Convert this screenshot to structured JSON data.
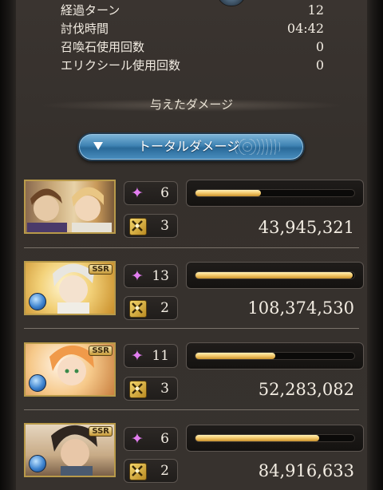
{
  "stats": [
    {
      "label": "経過ターン",
      "value": "12"
    },
    {
      "label": "討伐時間",
      "value": "04:42"
    },
    {
      "label": "召喚石使用回数",
      "value": "0"
    },
    {
      "label": "エリクシール使用回数",
      "value": "0"
    }
  ],
  "section_title": "与えたダメージ",
  "dropdown": {
    "label": "トータルダメージ",
    "icon": "triangle-down-icon"
  },
  "characters": [
    {
      "name_id": "character-1",
      "portrait": "two-character-portrait",
      "rarity": "",
      "element": "",
      "charge_count": "6",
      "skill_count": "3",
      "gauge_fraction": 0.41,
      "damage": "43,945,321"
    },
    {
      "name_id": "character-2",
      "portrait": "white-hair-portrait",
      "rarity": "SSR",
      "element": "water",
      "charge_count": "13",
      "skill_count": "2",
      "gauge_fraction": 0.99,
      "damage": "108,374,530"
    },
    {
      "name_id": "character-3",
      "portrait": "orange-hair-portrait",
      "rarity": "SSR",
      "element": "water",
      "charge_count": "11",
      "skill_count": "3",
      "gauge_fraction": 0.5,
      "damage": "52,283,082"
    },
    {
      "name_id": "character-4",
      "portrait": "dark-hair-portrait",
      "rarity": "SSR",
      "element": "water",
      "charge_count": "6",
      "skill_count": "2",
      "gauge_fraction": 0.78,
      "damage": "84,916,633"
    }
  ],
  "colors": {
    "gauge": "#f3c96b",
    "dropdown": "#3f83b3",
    "charge_icon": "#e27ef0",
    "element_water": "#3e84cf"
  }
}
